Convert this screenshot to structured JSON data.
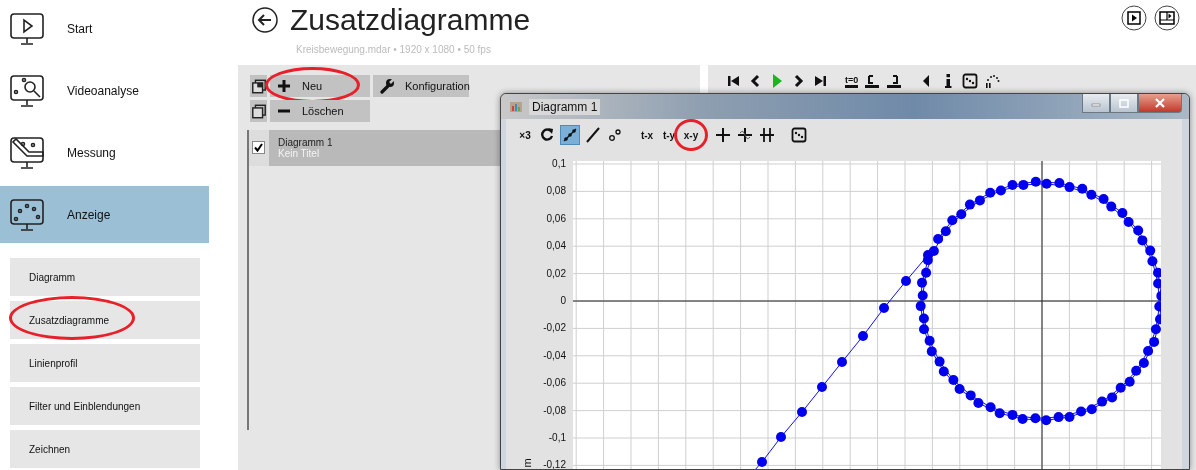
{
  "sidebar": {
    "items": [
      {
        "label": "Start",
        "selected": false
      },
      {
        "label": "Videoanalyse",
        "selected": false
      },
      {
        "label": "Messung",
        "selected": false
      },
      {
        "label": "Anzeige",
        "selected": true
      }
    ],
    "subitems": [
      {
        "label": "Diagramm",
        "highlighted": false
      },
      {
        "label": "Zusatzdiagramme",
        "highlighted": true
      },
      {
        "label": "Linienprofil",
        "highlighted": false
      },
      {
        "label": "Filter und Einblendungen",
        "highlighted": false
      },
      {
        "label": "Zeichnen",
        "highlighted": false
      }
    ]
  },
  "header": {
    "title": "Zusatzdiagramme",
    "subtitle": "Kreisbewegung.mdar • 1920 x 1080 • 50 fps"
  },
  "diagram_panel": {
    "buttons": [
      {
        "label": "Neu",
        "highlighted": true
      },
      {
        "label": "Konfiguration",
        "highlighted": false
      },
      {
        "label": "Löschen",
        "highlighted": false
      }
    ],
    "list": [
      {
        "title": "Diagramm 1",
        "subtitle": "Kein Titel",
        "checked": true,
        "selected": true
      }
    ]
  },
  "player_toolbar": [
    {
      "kind": "icon"
    },
    {
      "kind": "icon"
    },
    {
      "kind": "icon"
    },
    {
      "kind": "icon"
    },
    {
      "kind": "icon"
    },
    {
      "kind": "text",
      "label": "t=0"
    },
    {
      "kind": "icon"
    },
    {
      "kind": "icon"
    },
    {
      "kind": "icon"
    },
    {
      "kind": "icon"
    },
    {
      "kind": "icon"
    },
    {
      "kind": "icon"
    }
  ],
  "window": {
    "title": "Diagramm 1",
    "toolbar": [
      {
        "kind": "text",
        "label": "×3",
        "selected": false,
        "highlighted": false
      },
      {
        "kind": "icon",
        "selected": false,
        "highlighted": false
      },
      {
        "kind": "icon",
        "selected": true,
        "highlighted": false
      },
      {
        "kind": "icon",
        "selected": false,
        "highlighted": false
      },
      {
        "kind": "icon",
        "selected": false,
        "highlighted": false
      },
      {
        "kind": "text",
        "label": "t-x",
        "selected": false,
        "highlighted": false
      },
      {
        "kind": "text",
        "label": "t-y",
        "selected": false,
        "highlighted": false
      },
      {
        "kind": "text",
        "label": "x-y",
        "selected": false,
        "highlighted": true
      },
      {
        "kind": "icon",
        "selected": false,
        "highlighted": false
      },
      {
        "kind": "icon",
        "selected": false,
        "highlighted": false
      },
      {
        "kind": "icon",
        "selected": false,
        "highlighted": false
      },
      {
        "kind": "icon",
        "selected": false,
        "highlighted": false
      }
    ],
    "chart": {
      "yticks": [
        "0,1",
        "0,08",
        "0,06",
        "0,04",
        "0,02",
        "0",
        "-0,02",
        "-0,04",
        "-0,06",
        "-0,08",
        "-0,1",
        "-0,12"
      ],
      "ylabel": "m"
    }
  }
}
